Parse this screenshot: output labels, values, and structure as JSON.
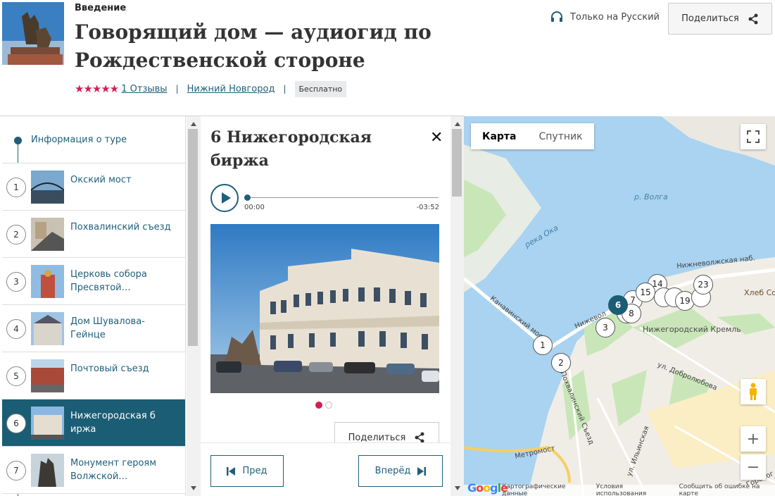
{
  "header": {
    "kicker": "Введение",
    "title": "Говорящий дом — аудиогид по Рождественской стороне",
    "rating_stars": "★★★★★",
    "reviews_link": "1 Отзывы",
    "city_link": "Нижний Новгород",
    "price_badge": "Бесплатно",
    "language": "Только на Русский",
    "share_label": "Поделиться"
  },
  "sidebar": {
    "info_label": "Информация о туре",
    "stops": [
      {
        "num": "1",
        "label": "Окский мост"
      },
      {
        "num": "2",
        "label": "Похвалинский съезд"
      },
      {
        "num": "3",
        "label": "Церковь собора Пресвятой…"
      },
      {
        "num": "4",
        "label": "Дом Шувалова-Гейнце"
      },
      {
        "num": "5",
        "label": "Почтовый съезд"
      },
      {
        "num": "6",
        "label": "Нижегородская б иржа"
      },
      {
        "num": "7",
        "label": "Монумент героям Волжской…"
      }
    ],
    "active_stop": "6"
  },
  "detail": {
    "title": "6 Нижегородская биржа",
    "time_start": "00:00",
    "time_end": "-03:52",
    "share_label": "Поделиться",
    "prev_label": "Пред",
    "next_label": "Вперёд"
  },
  "map": {
    "tab_map": "Карта",
    "tab_satellite": "Спутник",
    "google": "Google",
    "footer_data": "Картографические данные",
    "footer_terms": "Условия использования",
    "footer_report": "Сообщить об ошибке на карте",
    "labels": {
      "volga": "р. Волга",
      "oka": "река Ока",
      "kanavinsky": "Канавинский мост",
      "nizhnevolzh": "Нижневолжская наб.",
      "kreml": "Нижегородский Кремль",
      "khleb": "Хлеб Со",
      "dobrolyubova": "ул. Добролюбова",
      "pokhvalinsky": "ул. Похвалинский Съезд",
      "ilyinskaya": "ул. Ильинская",
      "metromost": "Метромост",
      "nizhneu": "Нижевол",
      "gorky": "Горьког"
    },
    "markers": [
      "1",
      "2",
      "3",
      "6",
      "7",
      "8",
      "14",
      "15",
      "19",
      "23"
    ]
  },
  "colors": {
    "accent": "#1b5d74",
    "star": "#d81b55",
    "water": "#a9d3f0"
  }
}
